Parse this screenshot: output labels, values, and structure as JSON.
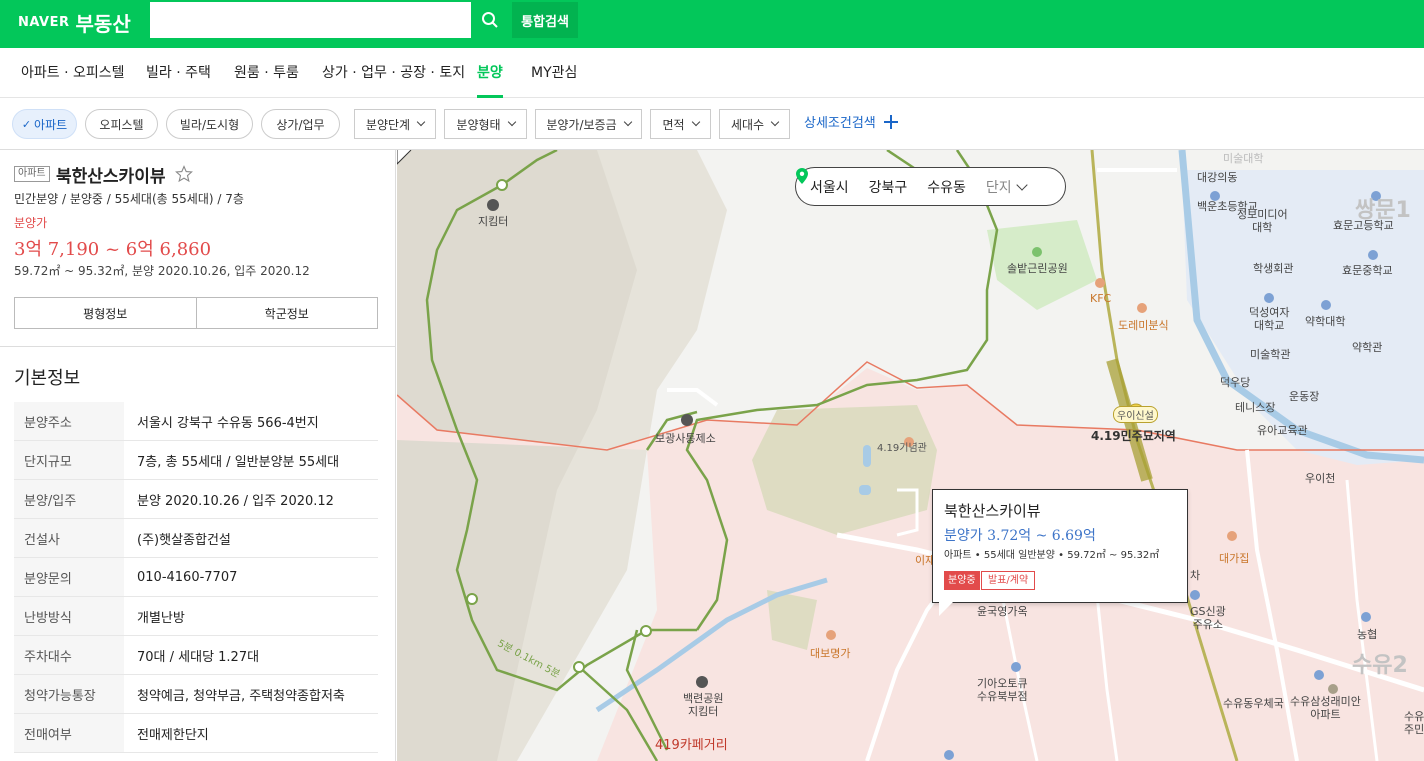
{
  "header": {
    "logo_naver": "NAVER",
    "logo_service": "부동산",
    "search_placeholder": "",
    "search_value": "",
    "total_search_label": "통합검색"
  },
  "nav": {
    "items": [
      "아파트 · 오피스텔",
      "빌라 · 주택",
      "원룸 · 투룸",
      "상가 · 업무 · 공장 · 토지",
      "분양",
      "MY관심"
    ],
    "active": "분양"
  },
  "filters": {
    "chips": [
      "아파트",
      "오피스텔",
      "빌라/도시형",
      "상가/업무"
    ],
    "dropdowns": [
      "분양단계",
      "분양형태",
      "분양가/보증금",
      "면적",
      "세대수"
    ],
    "detail_search": "상세조건검색"
  },
  "panel": {
    "type_badge": "아파트",
    "name": "북한산스카이뷰",
    "summary": "민간분양 / 분양중 / 55세대(총 55세대) / 7층",
    "price_label": "분양가",
    "price_range": "3억 7,190 ~ 6억 6,860",
    "area_info": "59.72㎡ ~ 95.32㎡, 분양 2020.10.26, 입주 2020.12",
    "tabs": [
      "평형정보",
      "학군정보"
    ],
    "section_title": "기본정보",
    "rows": [
      {
        "key": "분양주소",
        "value": "서울시 강북구 수유동 566-4번지"
      },
      {
        "key": "단지규모",
        "value": "7층, 총 55세대 / 일반분양분 55세대"
      },
      {
        "key": "분양/입주",
        "value": "분양 2020.10.26 / 입주 2020.12"
      },
      {
        "key": "건설사",
        "value": "(주)햇살종합건설"
      },
      {
        "key": "분양문의",
        "value": "010-4160-7707"
      },
      {
        "key": "난방방식",
        "value": "개별난방"
      },
      {
        "key": "주차대수",
        "value": "70대 / 세대당 1.27대"
      },
      {
        "key": "청약가능통장",
        "value": "청약예금, 청약부금, 주택청약종합저축"
      },
      {
        "key": "전매여부",
        "value": "전매제한단지"
      }
    ]
  },
  "map": {
    "region": {
      "city": "서울시",
      "district": "강북구",
      "dong": "수유동",
      "level": "단지"
    },
    "popup": {
      "name": "북한산스카이뷰",
      "price": "분양가 3.72억 ~ 6.69억",
      "info": "아파트 • 55세대 일반분양 • 59.72㎡ ~ 95.32㎡",
      "tag_status": "분양중",
      "tag_result": "발표/계약"
    },
    "labels": {
      "jikiteo1": "지킴터",
      "boryeong": "보광사통제소",
      "memorial": "4.19기념관",
      "baekryeon": "백련공원\n지킴터",
      "cafe": "419카페거리",
      "trail": "5분 0.1km 5분",
      "sollbat": "솔밭근린공원",
      "kfc": "KFC",
      "dorami": "도레미분식",
      "station_badge": "우이신설",
      "station_area": "4.19민주묘지역",
      "uicheon": "우이천",
      "daebo": "대보명가",
      "gs": "GS신광\n주유소",
      "kia": "기아오토큐\n수유북부점",
      "post": "수유동우체국",
      "apt": "수유삼성래미안\n아파트",
      "daega": "대가집",
      "nonghyup": "농협",
      "daegang": "대강의동",
      "baekun": "백운초등학교",
      "jeongbo": "정보미디어\n대학",
      "hyomun_high": "효문고등학교",
      "haksaeng": "학생회관",
      "hyomun_mid": "효문중학교",
      "deokseong": "덕성여자\n대학교",
      "yakhak": "약학대학",
      "yakhakgwan": "약학관",
      "misulhak": "미술학관",
      "deokudang": "덕우당",
      "undong": "운동장",
      "tennis": "테니스장",
      "yua": "유아교육관",
      "ssangmun": "쌍문1",
      "suyu2": "수유2",
      "misul_top": "미술대학",
      "ijae": "이재",
      "gyeongjae": "윤국영가옥",
      "jumin": "수유\n주민",
      "car": "차"
    }
  }
}
